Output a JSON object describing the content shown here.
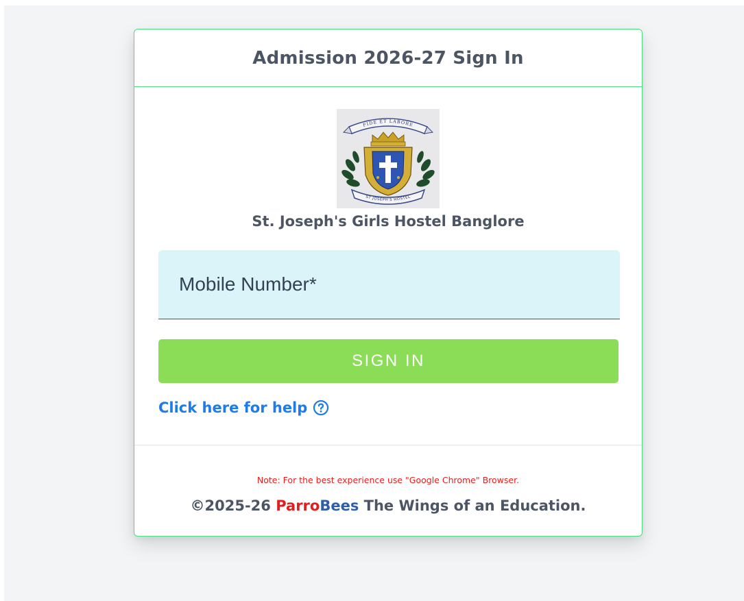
{
  "card": {
    "title": "Admission 2026-27 Sign In"
  },
  "org": {
    "name": "St. Joseph's Girls Hostel Banglore",
    "crest_motto": "FIDE ET LABORE",
    "crest_banner": "ST JOSEPH'S HOSTEL"
  },
  "form": {
    "mobile_placeholder": "Mobile Number*",
    "mobile_value": "",
    "signin_label": "SIGN IN",
    "help_label": "Click here for help"
  },
  "footer": {
    "note": "Note: For the best experience use \"Google Chrome\" Browser.",
    "copyright_prefix": "©2025-26 ",
    "brand_part1": "Parro",
    "brand_part2": "Bees",
    "tagline": " The Wings of an Education."
  },
  "icons": {
    "help": "question-circle-icon",
    "crest": "school-crest-icon"
  },
  "colors": {
    "accent_green": "#8bdd57",
    "card_border": "#4ade80",
    "link_blue": "#1d7ce9",
    "input_bg": "#dbf4f9",
    "note_red": "#ef1b1b",
    "brand_red": "#e11d1d",
    "brand_blue": "#2f5ea8"
  }
}
